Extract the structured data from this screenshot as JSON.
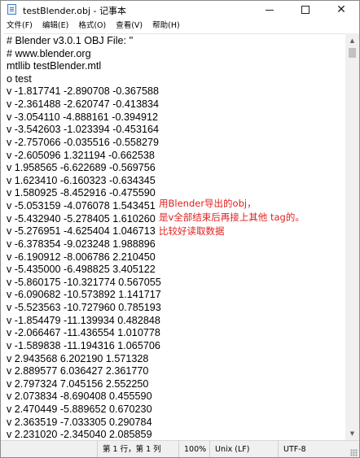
{
  "window": {
    "title": "testBlender.obj - 记事本",
    "controls": {
      "minimize_icon": "minimize-icon",
      "maximize_icon": "maximize-icon",
      "close_icon": "close-icon",
      "close_glyph": "✕"
    }
  },
  "menu": [
    {
      "label": "文件(F)"
    },
    {
      "label": "编辑(E)"
    },
    {
      "label": "格式(O)"
    },
    {
      "label": "查看(V)"
    },
    {
      "label": "帮助(H)"
    }
  ],
  "editor": {
    "lines": [
      "# Blender v3.0.1 OBJ File: ''",
      "# www.blender.org",
      "mtllib testBlender.mtl",
      "o test",
      "v -1.817741 -2.890708 -0.367588",
      "v -2.361488 -2.620747 -0.413834",
      "v -3.054110 -4.888161 -0.394912",
      "v -3.542603 -1.023394 -0.453164",
      "v -2.757066 -0.035516 -0.558279",
      "v -2.605096 1.321194 -0.662538",
      "v 1.958565 -6.622689 -0.569756",
      "v 1.623410 -6.160323 -0.634345",
      "v 1.580925 -8.452916 -0.475590",
      "v -5.053159 -4.076078 1.543451",
      "v -5.432940 -5.278405 1.610260",
      "v -5.276951 -4.625404 1.046713",
      "v -6.378354 -9.023248 1.988896",
      "v -6.190912 -8.006786 2.210450",
      "v -5.435000 -6.498825 3.405122",
      "v -5.860175 -10.321774 0.567055",
      "v -6.090682 -10.573892 1.141717",
      "v -5.523563 -10.727960 0.785193",
      "v -1.854479 -11.139934 0.482848",
      "v -2.066467 -11.436554 1.010778",
      "v -1.589838 -11.194316 1.065706",
      "v 2.943568 6.202190 1.571328",
      "v 2.889577 6.036427 2.361770",
      "v 2.797324 7.045156 2.552250",
      "v 2.073834 -8.690408 0.455590",
      "v 2.470449 -5.889652 0.670230",
      "v 2.363519 -7.033305 0.290784",
      "v 2.231020 -2.345040 2.085859"
    ]
  },
  "annotation": {
    "lines": [
      "用Blender导出的obj，",
      "是v全部结束后再接上其他 tag的。",
      "比较好读取数据"
    ],
    "color": "#e02020"
  },
  "scrollbar": {
    "up_icon": "chevron-up-icon",
    "down_icon": "chevron-down-icon"
  },
  "status": {
    "position": "第 1 行，第 1 列",
    "zoom": "100%",
    "line_ending": "Unix (LF)",
    "encoding": "UTF-8"
  }
}
